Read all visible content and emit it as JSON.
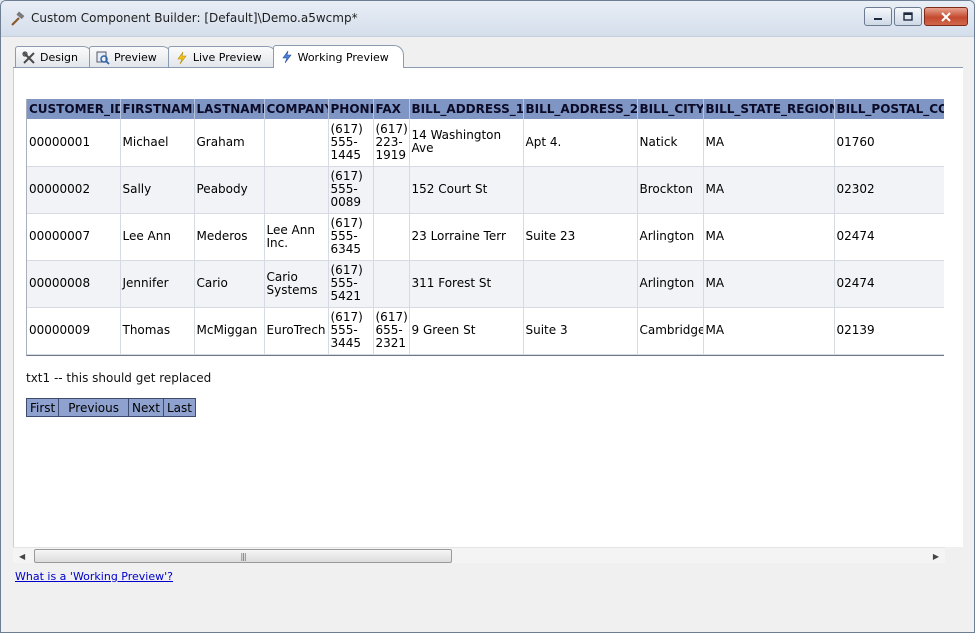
{
  "window": {
    "title": "Custom Component Builder: [Default]\\Demo.a5wcmp*"
  },
  "tabs": [
    {
      "label": "Design",
      "icon": "tools-icon"
    },
    {
      "label": "Preview",
      "icon": "magnifier-icon"
    },
    {
      "label": "Live Preview",
      "icon": "lightning-icon"
    },
    {
      "label": "Working Preview",
      "icon": "lightning-icon"
    }
  ],
  "grid": {
    "columns": [
      "CUSTOMER_ID",
      "FIRSTNAME",
      "LASTNAME",
      "COMPANY",
      "PHONE",
      "FAX",
      "BILL_ADDRESS_1",
      "BILL_ADDRESS_2",
      "BILL_CITY",
      "BILL_STATE_REGION",
      "BILL_POSTAL_CO"
    ],
    "rows": [
      [
        "00000001",
        "Michael",
        "Graham",
        "",
        "(617) 555-1445",
        "(617) 223-1919",
        "14 Washington Ave",
        "Apt 4.",
        "Natick",
        "MA",
        "01760"
      ],
      [
        "00000002",
        "Sally",
        "Peabody",
        "",
        "(617) 555-0089",
        "",
        "152 Court St",
        "",
        "Brockton",
        "MA",
        "02302"
      ],
      [
        "00000007",
        "Lee Ann",
        "Mederos",
        "Lee Ann Inc.",
        "(617) 555-6345",
        "",
        "23 Lorraine Terr",
        "Suite 23",
        "Arlington",
        "MA",
        "02474"
      ],
      [
        "00000008",
        "Jennifer",
        "Cario",
        "Cario Systems",
        "(617) 555-5421",
        "",
        "311 Forest St",
        "",
        "Arlington",
        "MA",
        "02474"
      ],
      [
        "00000009",
        "Thomas",
        "McMiggan",
        "EuroTrech",
        "(617) 555-3445",
        "(617) 655-2321",
        "9 Green St",
        "Suite 3",
        "Cambridge",
        "MA",
        "02139"
      ]
    ]
  },
  "txt1": "txt1 -- this should get replaced",
  "pager": {
    "first": "First",
    "previous": "Previous",
    "next": "Next",
    "last": "Last"
  },
  "help_link": "What is a 'Working Preview'?",
  "colors": {
    "header_bg": "#7f95c3",
    "pager_bg": "#8ea1cf",
    "link": "#0000cc"
  }
}
